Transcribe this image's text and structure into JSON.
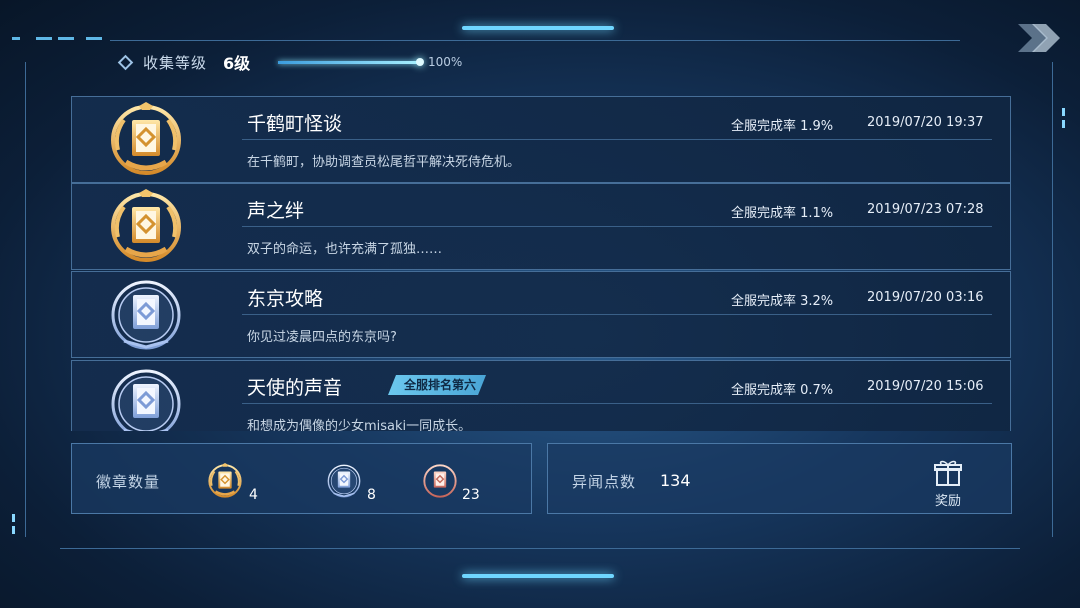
{
  "header": {
    "title": "收集等级",
    "level": "6级",
    "progress": 1.0,
    "progress_text": "100%"
  },
  "achievements": [
    {
      "title": "千鹤町怪谈",
      "description": "在千鹤町，协助调查员松尾哲平解决死侍危机。",
      "rate": "全服完成率 1.9%",
      "date": "2019/07/20 19:37",
      "badge": "gold",
      "tag": ""
    },
    {
      "title": "声之绊",
      "description": "双子的命运，也许充满了孤独……",
      "rate": "全服完成率 1.1%",
      "date": "2019/07/23 07:28",
      "badge": "gold",
      "tag": ""
    },
    {
      "title": "东京攻略",
      "description": "你见过凌晨四点的东京吗?",
      "rate": "全服完成率 3.2%",
      "date": "2019/07/20 03:16",
      "badge": "silver",
      "tag": ""
    },
    {
      "title": "天使的声音",
      "description": "和想成为偶像的少女misaki一同成长。",
      "rate": "全服完成率 0.7%",
      "date": "2019/07/20 15:06",
      "badge": "silver",
      "tag": "全服排名第六"
    }
  ],
  "badge_summary": {
    "label": "徽章数量",
    "counts": [
      {
        "type": "gold",
        "count": "4"
      },
      {
        "type": "silver",
        "count": "8"
      },
      {
        "type": "bronze",
        "count": "23"
      }
    ]
  },
  "points": {
    "label": "异闻点数",
    "value": "134",
    "reward_label": "奖励"
  },
  "colors": {
    "gold": "#f0b24a",
    "silver": "#a9c4f2",
    "bronze": "#e08a78",
    "accent": "#6fd6ff"
  }
}
